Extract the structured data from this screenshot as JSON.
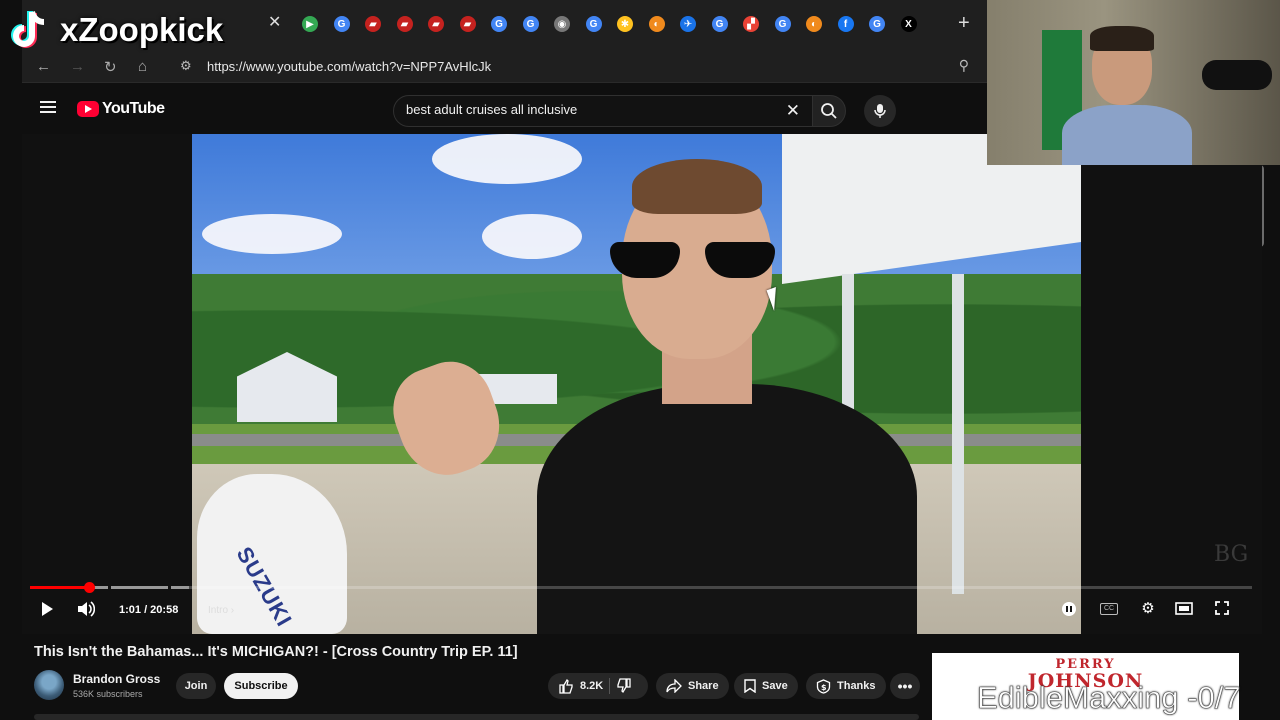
{
  "overlay": {
    "streamer_name": "xZoopkick",
    "ticker": "EdibleMaxxing -0/7"
  },
  "browser": {
    "url": "https://www.youtube.com/watch?v=NPP7AvHlcJk",
    "tab_icons": [
      {
        "name": "play-tab-icon",
        "color": "#34a853",
        "glyph": "▶"
      },
      {
        "name": "google-tab-icon",
        "color": "#4285f4",
        "glyph": "G"
      },
      {
        "name": "slides-tab-icon",
        "color": "#c5221f",
        "glyph": "▰"
      },
      {
        "name": "slides-tab-icon",
        "color": "#c5221f",
        "glyph": "▰"
      },
      {
        "name": "slides-tab-icon",
        "color": "#c5221f",
        "glyph": "▰"
      },
      {
        "name": "slides-tab-icon",
        "color": "#c5221f",
        "glyph": "▰"
      },
      {
        "name": "google-tab-icon",
        "color": "#4285f4",
        "glyph": "G"
      },
      {
        "name": "google-tab-icon",
        "color": "#4285f4",
        "glyph": "G"
      },
      {
        "name": "chrome-tab-icon",
        "color": "#777777",
        "glyph": "◉"
      },
      {
        "name": "google-tab-icon",
        "color": "#4285f4",
        "glyph": "G"
      },
      {
        "name": "walmart-tab-icon",
        "color": "#ffc220",
        "glyph": "✱"
      },
      {
        "name": "edge-tab-icon",
        "color": "#f08a1d",
        "glyph": "◐"
      },
      {
        "name": "plane-tab-icon",
        "color": "#1a73e8",
        "glyph": "✈"
      },
      {
        "name": "google-tab-icon",
        "color": "#4285f4",
        "glyph": "G"
      },
      {
        "name": "app-tab-icon",
        "color": "#e94235",
        "glyph": "▞"
      },
      {
        "name": "google-tab-icon",
        "color": "#4285f4",
        "glyph": "G"
      },
      {
        "name": "edge-tab-icon",
        "color": "#f08a1d",
        "glyph": "◐"
      },
      {
        "name": "facebook-tab-icon",
        "color": "#1877f2",
        "glyph": "f"
      },
      {
        "name": "google-tab-icon",
        "color": "#4285f4",
        "glyph": "G"
      },
      {
        "name": "x-tab-icon",
        "color": "#000000",
        "glyph": "X"
      }
    ]
  },
  "youtube": {
    "logo_text": "YouTube",
    "search_value": "best adult cruises all inclusive",
    "player": {
      "time": "1:01 / 20:58",
      "chapter": "Intro",
      "progress_fraction": 0.0485
    },
    "video": {
      "title": "This Isn't the Bahamas... It's MICHIGAN?! - [Cross Country Trip EP. 11]",
      "channel": "Brandon Gross",
      "subscribers": "536K subscribers",
      "join_label": "Join",
      "subscribe_label": "Subscribe",
      "likes": "8.2K",
      "share_label": "Share",
      "save_label": "Save",
      "thanks_label": "Thanks"
    },
    "ad": {
      "line1": "PERRY",
      "line2": "JOHNSON"
    }
  },
  "colors": {
    "accent_red": "#ff0000",
    "youtube_red": "#ff0033",
    "background": "#0f0f0f"
  }
}
